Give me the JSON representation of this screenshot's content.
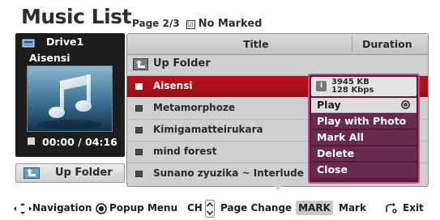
{
  "header": {
    "title": "Music List",
    "page_info": "Page 2/3",
    "marked_status": "No Marked"
  },
  "now_playing": {
    "drive": "Drive1",
    "artist": "Aisensi",
    "time": "00:00 / 04:16"
  },
  "up_folder_button": {
    "label": "Up Folder",
    "icon": "up-folder-icon"
  },
  "columns": {
    "title": "Title",
    "duration": "Duration"
  },
  "list": {
    "folder_row": "Up Folder",
    "items": [
      "Aisensi",
      "Metamorphoze",
      "Kimigamatteirukara",
      "mind forest",
      "Sunano zyuzika ~ Interlude ~"
    ],
    "selected_index": 0
  },
  "popup": {
    "file_size": "3945 KB",
    "bitrate": "128 Kbps",
    "items": [
      "Play",
      "Play with Photo",
      "Mark All",
      "Delete",
      "Close"
    ],
    "active_index": 0
  },
  "footer": {
    "navigation": "Navigation",
    "popup_menu": "Popup Menu",
    "ch_key": "CH",
    "page_change": "Page Change",
    "mark_key": "MARK",
    "mark": "Mark",
    "exit": "Exit"
  },
  "colors": {
    "selected_row": "#b01219",
    "popup_background": "#5a1c3a",
    "popup_border": "#c44b8b",
    "panel_background": "#1d1d1d"
  }
}
